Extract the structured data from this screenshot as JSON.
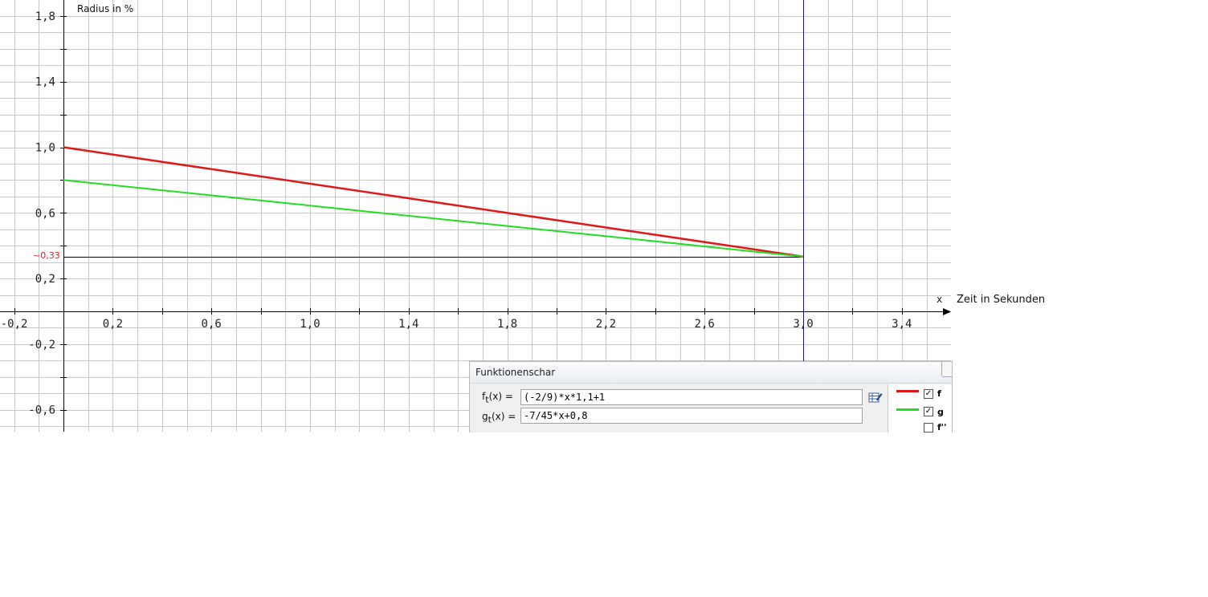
{
  "chart_data": {
    "type": "line",
    "xlabel": "Zeit in Sekunden",
    "xaxis_symbol": "x",
    "ylabel": "Radius in %",
    "xlim": [
      -0.26,
      3.52
    ],
    "ylim": [
      -0.74,
      1.89
    ],
    "x_tick_labels": [
      "-0,2",
      "0,2",
      "0,6",
      "1,0",
      "1,4",
      "1,8",
      "2,2",
      "2,6",
      "3,0",
      "3,4"
    ],
    "x_tick_values": [
      -0.2,
      0.2,
      0.6,
      1.0,
      1.4,
      1.8,
      2.2,
      2.6,
      3.0,
      3.4
    ],
    "y_tick_labels": [
      "1,8",
      "1,4",
      "1,0",
      "0,6",
      "0,2",
      "-0,2",
      "-0,6"
    ],
    "y_tick_values": [
      1.8,
      1.4,
      1.0,
      0.6,
      0.2,
      -0.2,
      -0.6
    ],
    "grid": true,
    "series": [
      {
        "name": "f",
        "color": "#e01818",
        "x": [
          0,
          3
        ],
        "y": [
          1.0,
          0.3333
        ]
      },
      {
        "name": "g",
        "color": "#22dd22",
        "x": [
          0,
          3
        ],
        "y": [
          0.8,
          0.3333
        ]
      }
    ],
    "vertical_line_x": 3.0,
    "horizontal_marker": {
      "y": 0.3333,
      "label": "~0,33"
    }
  },
  "panel": {
    "title": "Funktionenschar",
    "f_label": "f",
    "f_sub": "t",
    "f_suffix": "(x) =",
    "f_expr": "(-2/9)*x*1,1+1",
    "g_label": "g",
    "g_sub": "t",
    "g_suffix": "(x) =",
    "g_expr": "-7/45*x+0,8",
    "legend": [
      {
        "name": "f",
        "color": "#e01818",
        "checked": true
      },
      {
        "name": "g",
        "color": "#22dd22",
        "checked": true
      },
      {
        "name": "f''",
        "color": "",
        "checked": false
      }
    ],
    "edit_icon": "edit-table-icon"
  }
}
